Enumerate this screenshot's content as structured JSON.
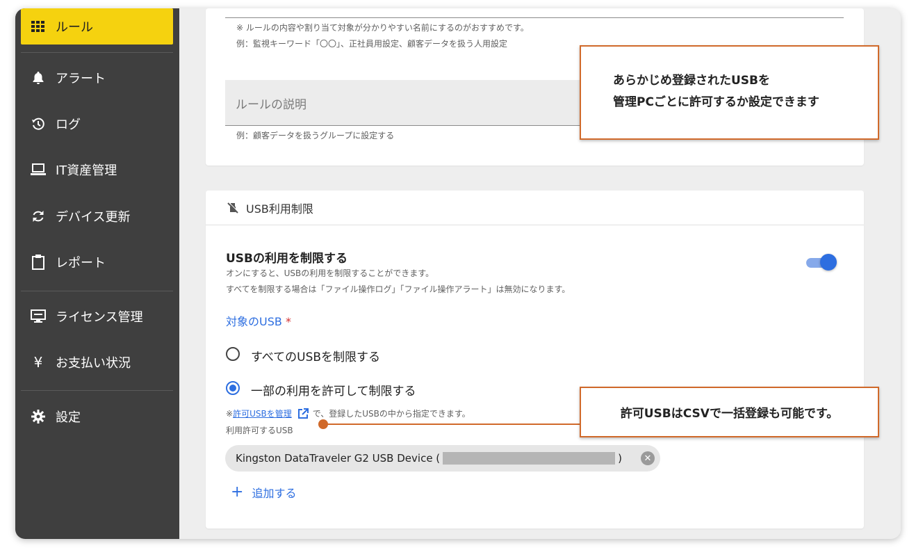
{
  "sidebar": {
    "items": [
      {
        "label": "ルール",
        "icon": "grid-icon",
        "active": true
      },
      {
        "label": "アラート",
        "icon": "bell-icon"
      },
      {
        "label": "ログ",
        "icon": "history-icon"
      },
      {
        "label": "IT資産管理",
        "icon": "laptop-icon"
      },
      {
        "label": "デバイス更新",
        "icon": "refresh-icon"
      },
      {
        "label": "レポート",
        "icon": "clipboard-icon"
      },
      {
        "label": "ライセンス管理",
        "icon": "monitor-icon"
      },
      {
        "label": "お支払い状況",
        "icon": "yen-icon"
      },
      {
        "label": "設定",
        "icon": "gear-icon"
      }
    ]
  },
  "rule_card": {
    "name_hint_1": "※ ルールの内容や割り当て対象が分かりやすい名前にするのがおすすめです。",
    "name_hint_2": "例：監視キーワード「〇〇」、正社員用設定、顧客データを扱う人用設定",
    "description_placeholder": "ルールの説明",
    "description_hint": "例：顧客データを扱うグループに設定する"
  },
  "usb_section": {
    "header": "USB利用制限",
    "header_icon": "usb-off-icon",
    "title": "USBの利用を制限する",
    "desc_1": "オンにすると、USBの利用を制限することができます。",
    "desc_2": "すべてを制限する場合は「ファイル操作ログ」「ファイル操作アラート」は無効になります。",
    "toggle_on": true,
    "target_label": "対象のUSB",
    "required_mark": "*",
    "options": [
      {
        "label": "すべてのUSBを制限する",
        "checked": false
      },
      {
        "label": "一部の利用を許可して制限する",
        "checked": true
      }
    ],
    "manage_prefix": "※",
    "manage_link": "許可USBを管理",
    "manage_suffix": "で、登録したUSBの中から指定できます。",
    "allowed_label": "利用許可するUSB",
    "device_name": "Kingston DataTraveler G2 USB Device (",
    "device_close": ")",
    "add_label": "追加する"
  },
  "callouts": {
    "top_line1": "あらかじめ登録されたUSBを",
    "top_line2": "管理PCごとに許可するか設定できます",
    "bottom": "許可USBはCSVで一括登録も可能です。"
  },
  "colors": {
    "sidebar_bg": "#3f3f3f",
    "active_item": "#f5d20f",
    "accent_blue": "#2d6ee0",
    "callout_border": "#d0692a"
  }
}
